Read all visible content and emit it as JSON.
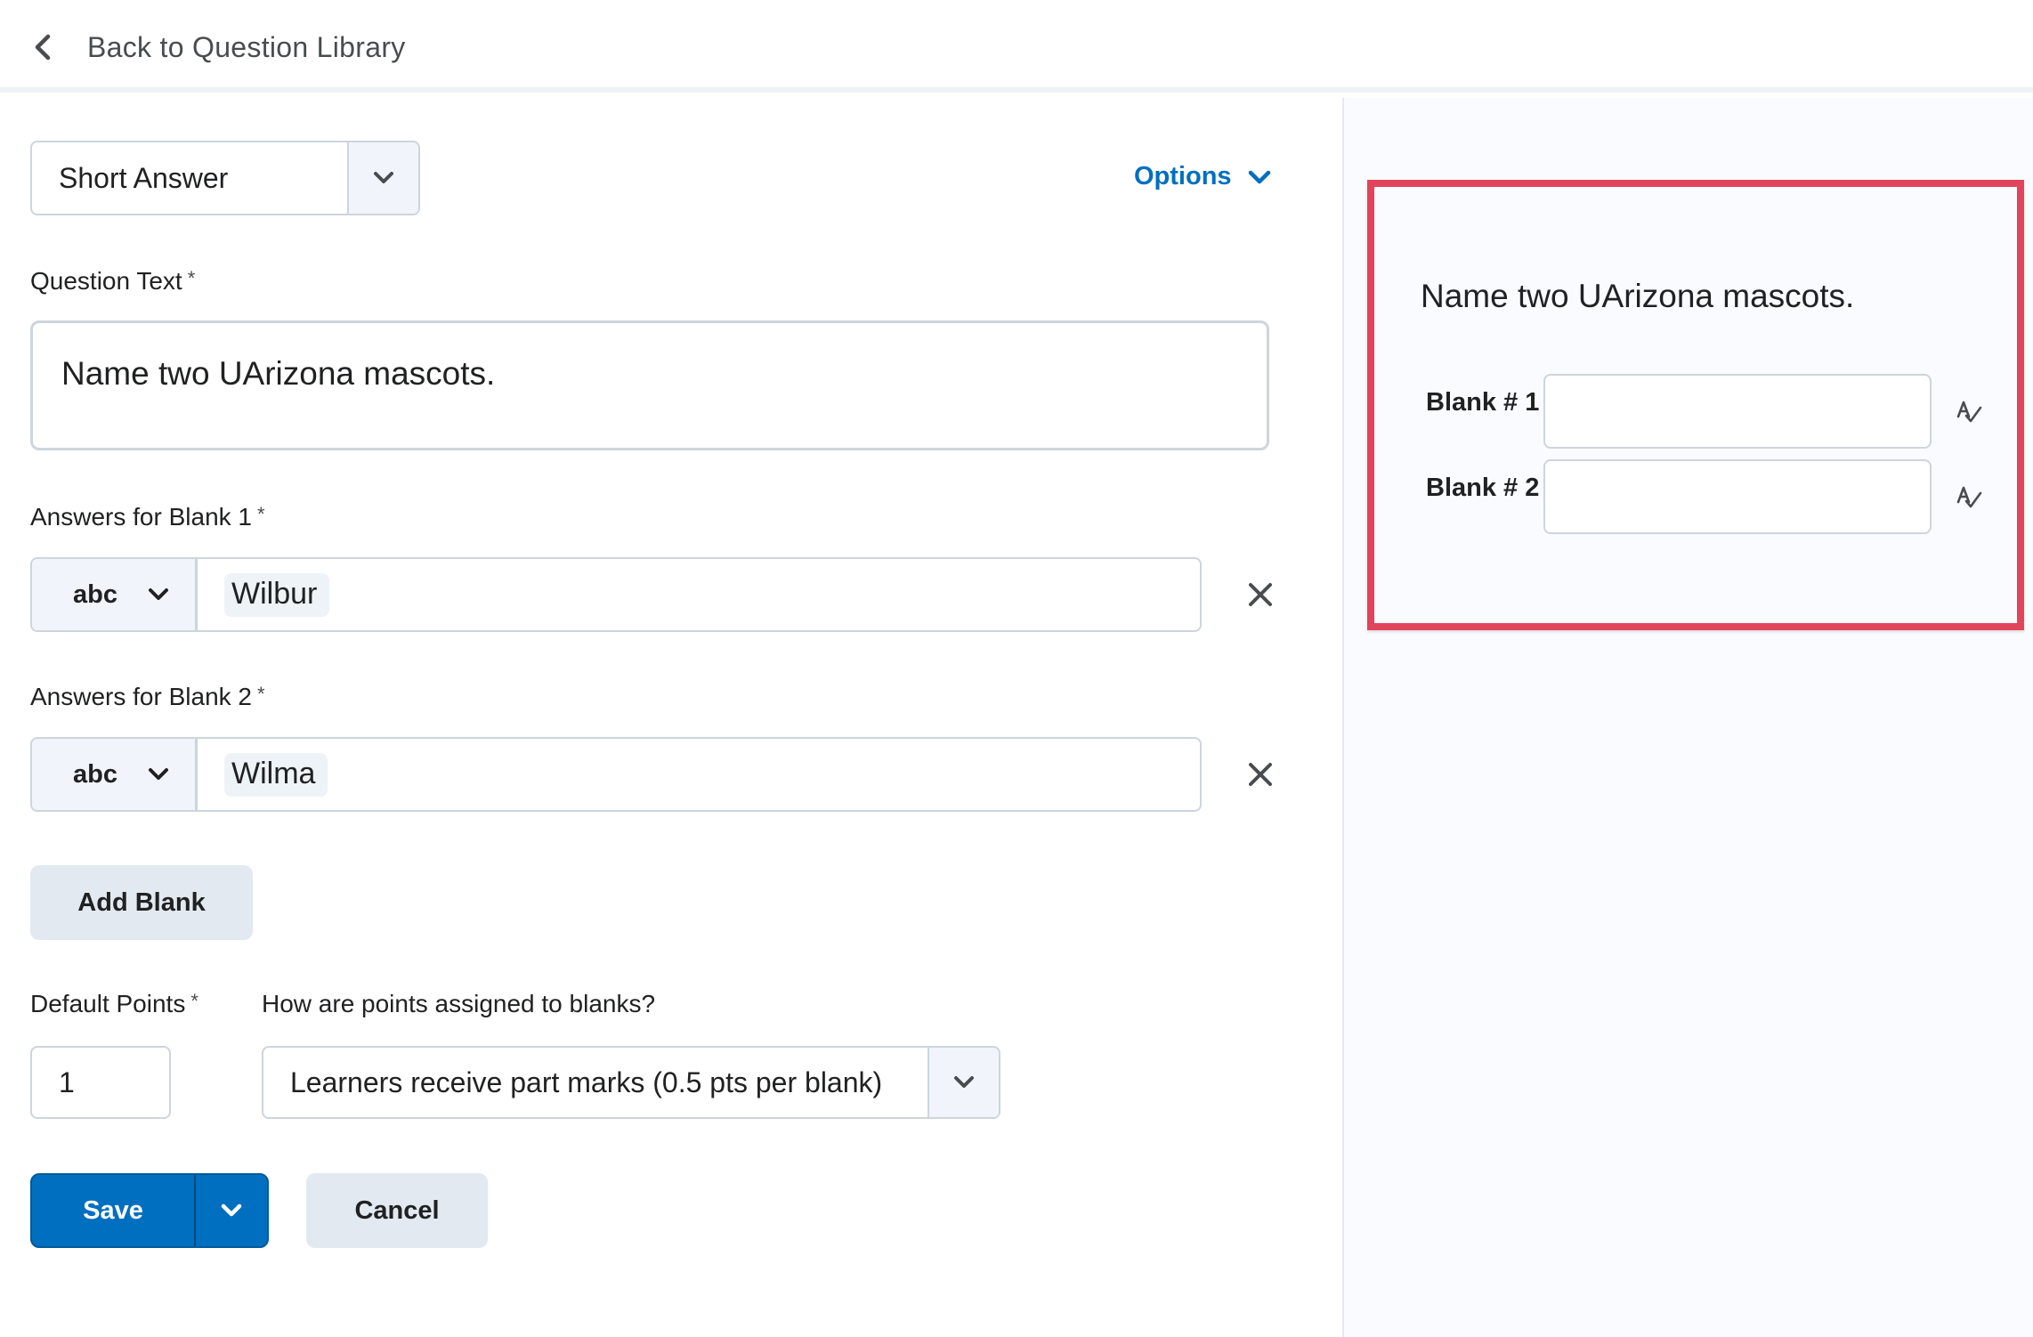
{
  "header": {
    "back_label": "Back to Question Library"
  },
  "editor": {
    "question_type": "Short Answer",
    "options_label": "Options",
    "question_text_label": "Question Text",
    "required_mark": "*",
    "question_text": "Name two UArizona mascots.",
    "blanks": [
      {
        "label": "Answers for Blank 1",
        "type": "abc",
        "answer": "Wilbur"
      },
      {
        "label": "Answers for Blank 2",
        "type": "abc",
        "answer": "Wilma"
      }
    ],
    "add_blank_label": "Add Blank",
    "default_points_label": "Default Points",
    "default_points_value": "1",
    "scoring_label": "How are points assigned to blanks?",
    "scoring_value": "Learners receive part marks (0.5 pts per blank)",
    "save_label": "Save",
    "cancel_label": "Cancel"
  },
  "preview": {
    "question_text": "Name two UArizona mascots.",
    "blanks": [
      {
        "label": "Blank # 1"
      },
      {
        "label": "Blank # 2"
      }
    ]
  },
  "colors": {
    "accent": "#006fbf",
    "highlight_border": "#e2445c",
    "button_grey": "#e3e9f1"
  },
  "icons": {
    "back": "chevron-left-icon",
    "dropdown": "chevron-down-icon",
    "remove": "close-icon",
    "spellcheck": "spellcheck-icon"
  }
}
